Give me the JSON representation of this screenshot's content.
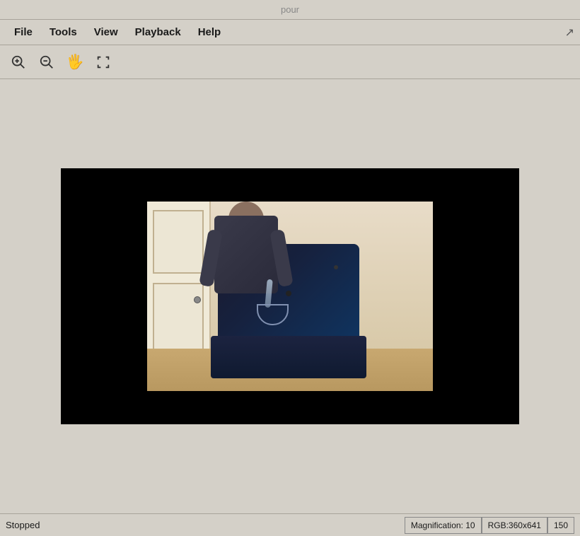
{
  "titleBar": {
    "title": "pour"
  },
  "menuBar": {
    "items": [
      {
        "id": "file",
        "label": "File"
      },
      {
        "id": "tools",
        "label": "Tools"
      },
      {
        "id": "view",
        "label": "View"
      },
      {
        "id": "playback",
        "label": "Playback"
      },
      {
        "id": "help",
        "label": "Help"
      }
    ]
  },
  "toolbar": {
    "zoomInLabel": "+",
    "zoomOutLabel": "-",
    "panLabel": "✋",
    "fitLabel": "⛶"
  },
  "statusBar": {
    "status": "Stopped",
    "magnification": "Magnification: 10",
    "resolution": "RGB:360x641",
    "value": "150"
  }
}
